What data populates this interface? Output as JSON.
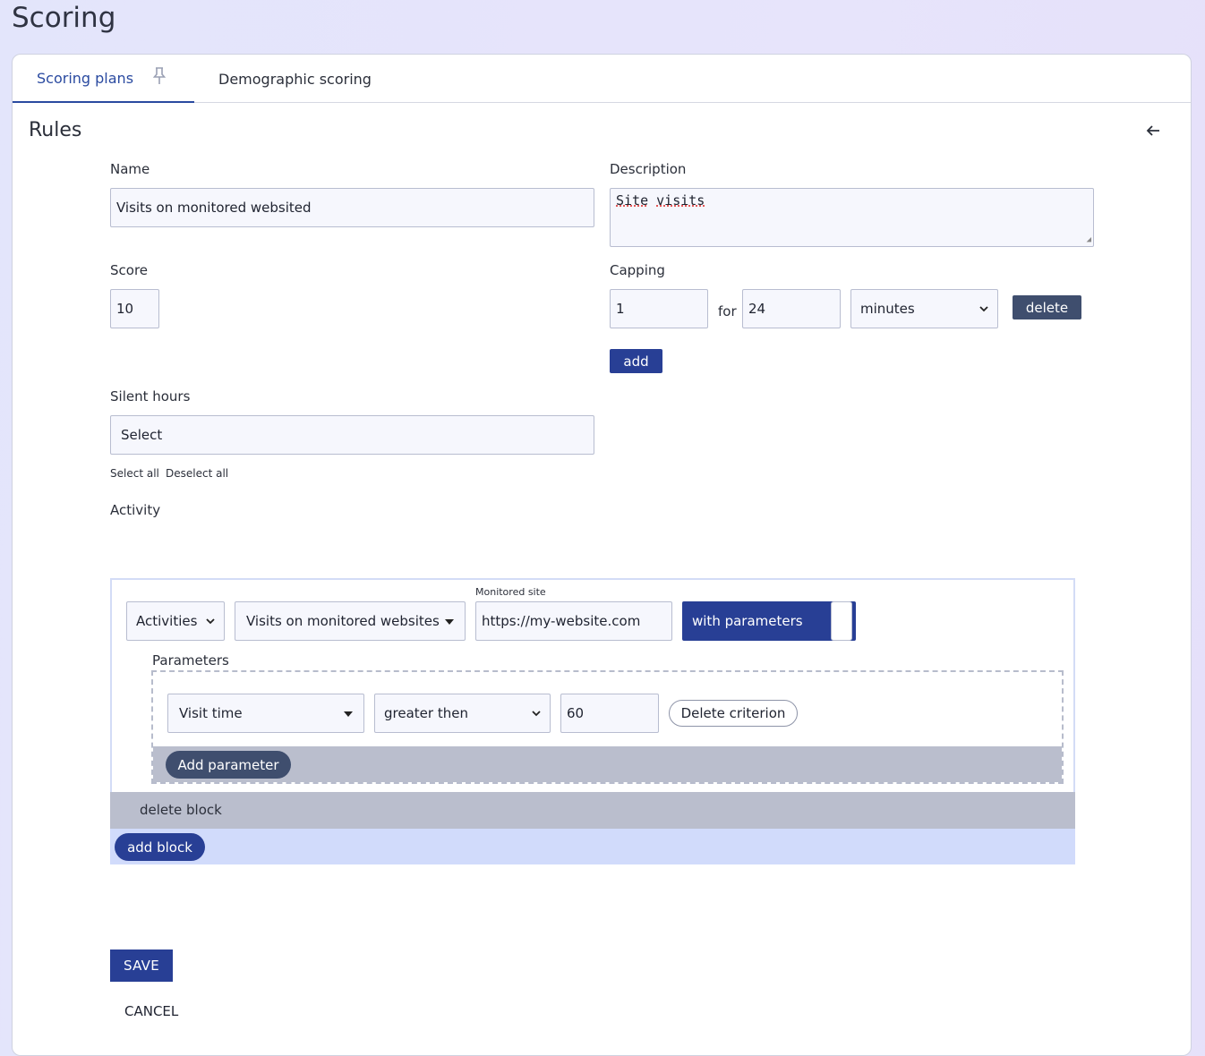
{
  "page": {
    "title": "Scoring"
  },
  "tabs": [
    {
      "label": "Scoring plans",
      "icon": "pin-icon",
      "active": true
    },
    {
      "label": "Demographic scoring",
      "active": false
    }
  ],
  "section": {
    "title": "Rules",
    "back_icon": "arrow-left-icon"
  },
  "form": {
    "name": {
      "label": "Name",
      "value": "Visits on monitored websited"
    },
    "description": {
      "label": "Description",
      "value_word1": "Site",
      "value_word2": "visits"
    },
    "score": {
      "label": "Score",
      "value": "10"
    },
    "capping": {
      "label": "Capping",
      "count": "1",
      "for_label": "for",
      "period": "24",
      "unit": "minutes",
      "delete_label": "delete",
      "add_label": "add"
    },
    "silent_hours": {
      "label": "Silent hours",
      "placeholder": "Select",
      "select_all": "Select all",
      "deselect_all": "Deselect all"
    },
    "activity": {
      "label": "Activity",
      "block": {
        "category": "Activities",
        "activity": "Visits on monitored websites",
        "site_label": "Monitored site",
        "site_value": "https://my-website.com",
        "toggle_label": "with parameters",
        "parameters_label": "Parameters",
        "criterion": {
          "field": "Visit time",
          "operator": "greater then",
          "value": "60",
          "delete_label": "Delete criterion"
        },
        "add_parameter_label": "Add parameter",
        "delete_block_label": "delete block"
      },
      "add_block_label": "add block"
    }
  },
  "actions": {
    "save_label": "SAVE",
    "cancel_label": "CANCEL"
  },
  "colors": {
    "primary": "#283f95",
    "secondary": "#3f4e6e",
    "footer_gray": "#babecd"
  }
}
